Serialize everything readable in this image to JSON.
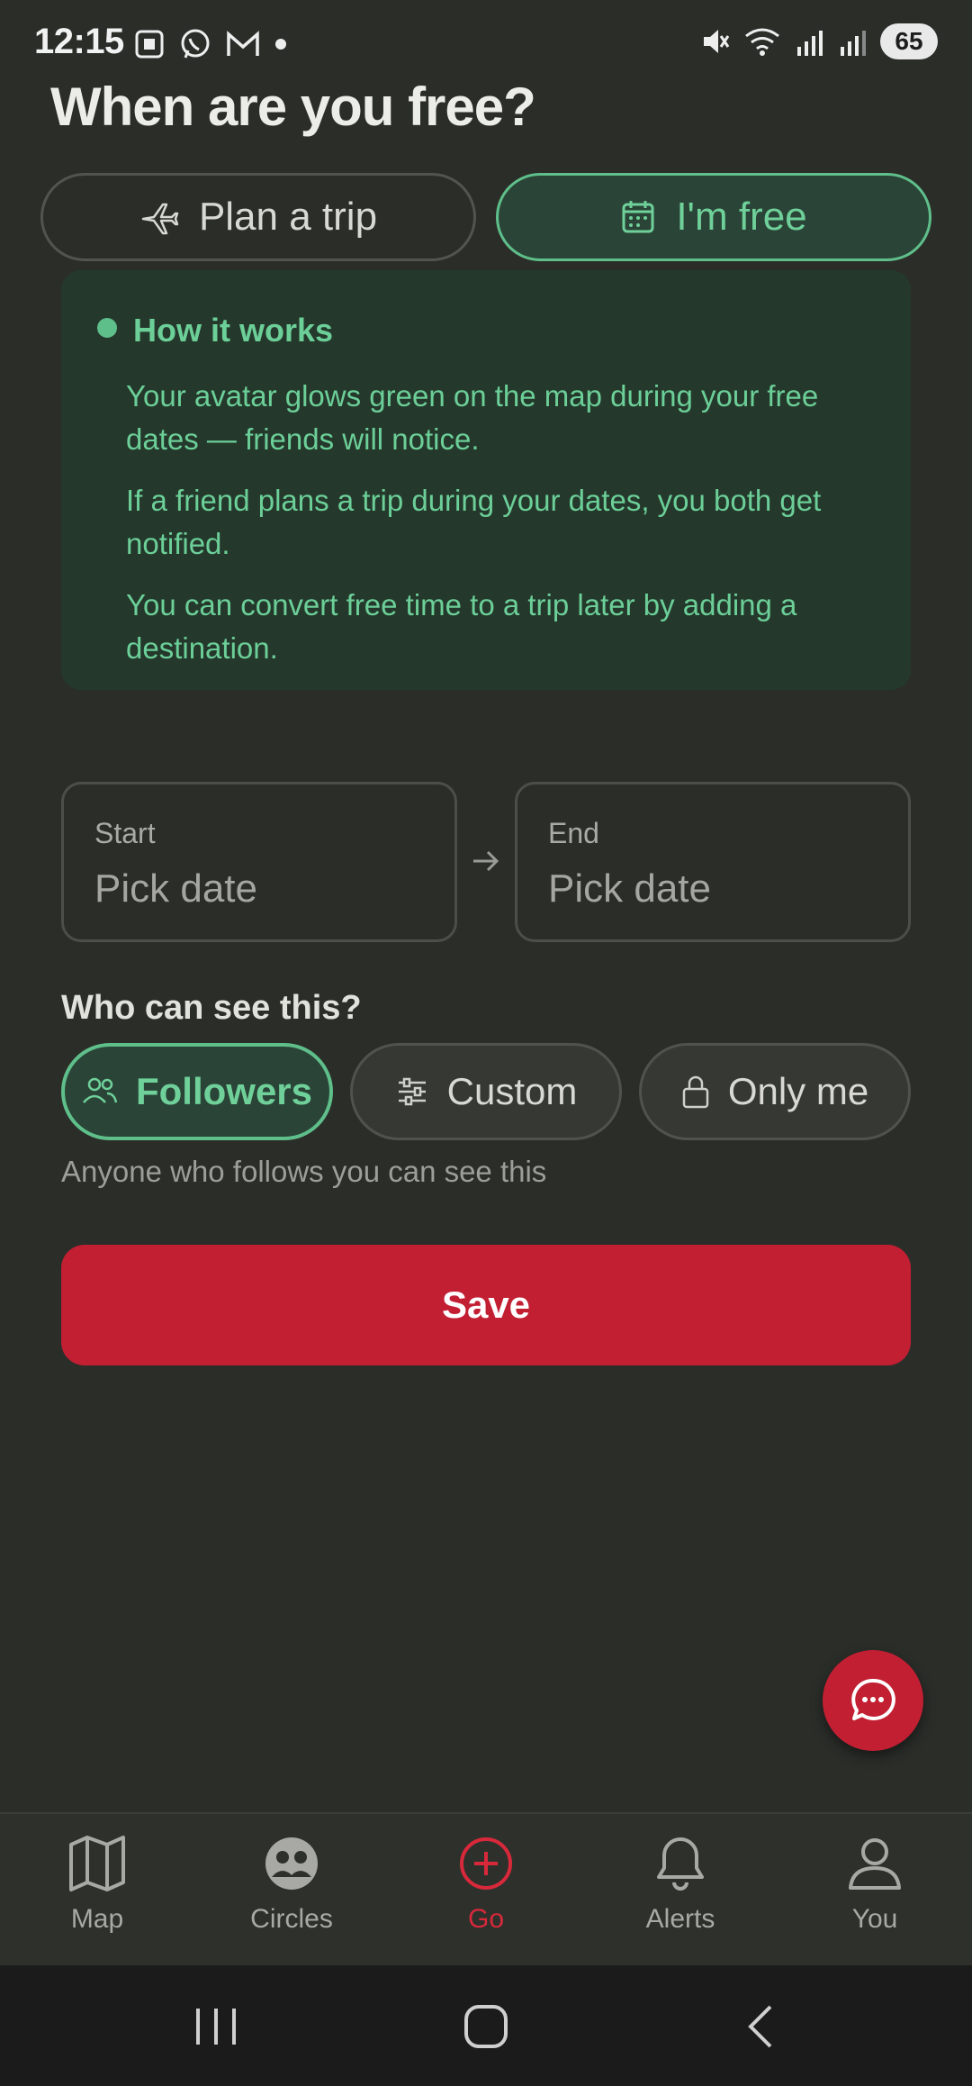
{
  "status_bar": {
    "time": "12:15",
    "battery": "65"
  },
  "page": {
    "title": "When are you free?"
  },
  "mode_toggle": {
    "plan_trip": "Plan a trip",
    "im_free": "I'm free",
    "selected": "I'm free"
  },
  "info": {
    "title": "How it works",
    "paragraphs": [
      "Your avatar glows green on the map during your free dates — friends will notice.",
      "If a friend plans a trip during your dates, you both get notified.",
      "You can convert free time to a trip later by adding a destination."
    ]
  },
  "dates": {
    "start_label": "Start",
    "start_value": "Pick date",
    "end_label": "End",
    "end_value": "Pick date"
  },
  "visibility": {
    "title": "Who can see this?",
    "options": [
      "Followers",
      "Custom",
      "Only me"
    ],
    "selected": "Followers",
    "hint": "Anyone who follows you can see this"
  },
  "actions": {
    "save": "Save"
  },
  "bottom_nav": {
    "items": [
      {
        "label": "Map",
        "icon": "map-icon"
      },
      {
        "label": "Circles",
        "icon": "circles-icon"
      },
      {
        "label": "Go",
        "icon": "plus-circle-icon"
      },
      {
        "label": "Alerts",
        "icon": "bell-icon"
      },
      {
        "label": "You",
        "icon": "user-icon"
      }
    ],
    "active": "Go"
  },
  "colors": {
    "background": "#2b2d29",
    "accent_green": "#5fbf8a",
    "accent_red": "#c21f33",
    "card_bg": "#24392c"
  }
}
